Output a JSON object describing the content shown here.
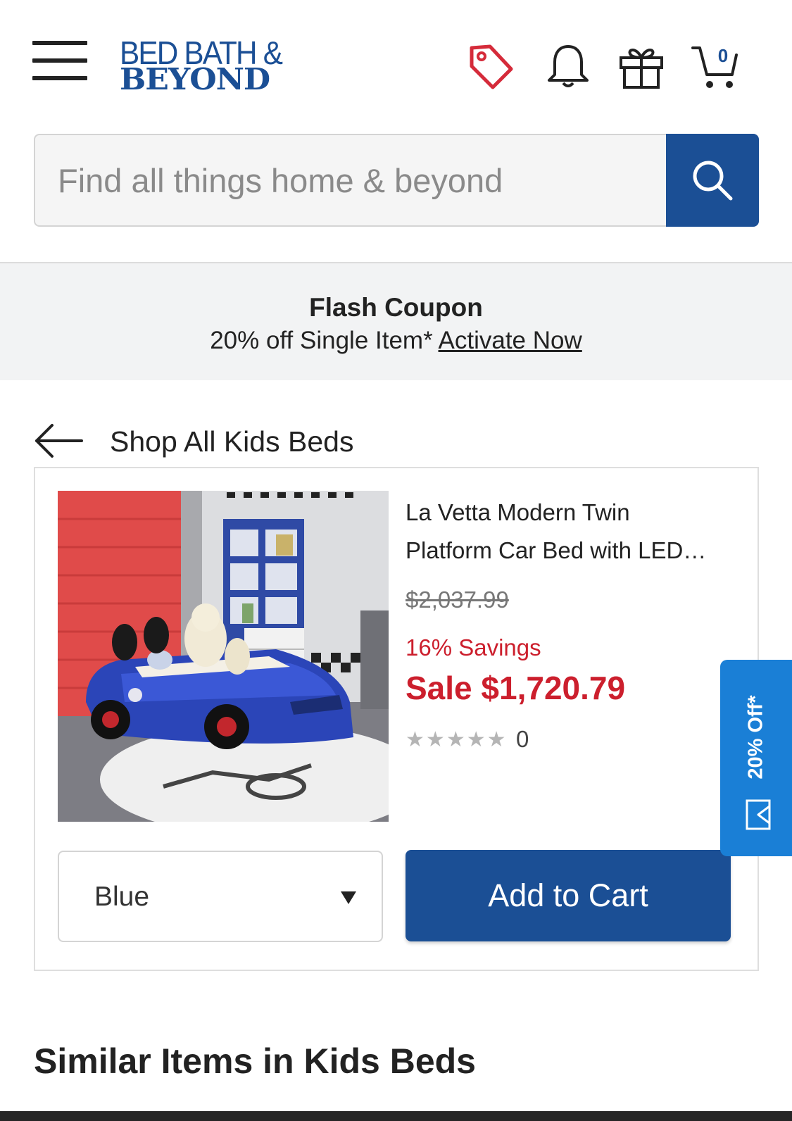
{
  "header": {
    "brand_line1": "BED BATH &",
    "brand_line2": "BEYOND",
    "cart_count": "0",
    "icons": [
      "menu-icon",
      "tag-icon",
      "bell-icon",
      "gift-icon",
      "cart-icon"
    ]
  },
  "search": {
    "placeholder": "Find all things home & beyond",
    "value": ""
  },
  "flash": {
    "title": "Flash Coupon",
    "subtitle": "20% off Single Item*",
    "link": "Activate Now"
  },
  "back_link": {
    "label": "Shop All Kids Beds"
  },
  "product": {
    "name_line1": "La Vetta Modern Twin",
    "name_line2": "Platform Car Bed with LED…",
    "original_price": "$2,037.99",
    "savings": "16% Savings",
    "sale_price": "Sale $1,720.79",
    "rating_stars": 0,
    "rating_max": 5,
    "review_count": "0",
    "variant": "Blue",
    "add_to_cart": "Add to Cart"
  },
  "side_tab": {
    "label": "20% Off*"
  },
  "similar": {
    "heading": "Similar Items in Kids Beds"
  },
  "colors": {
    "brand_blue": "#1b4f95",
    "sale_red": "#cc1f2d",
    "promo_blue": "#1a7fd6",
    "tag_red": "#d52b3a"
  }
}
